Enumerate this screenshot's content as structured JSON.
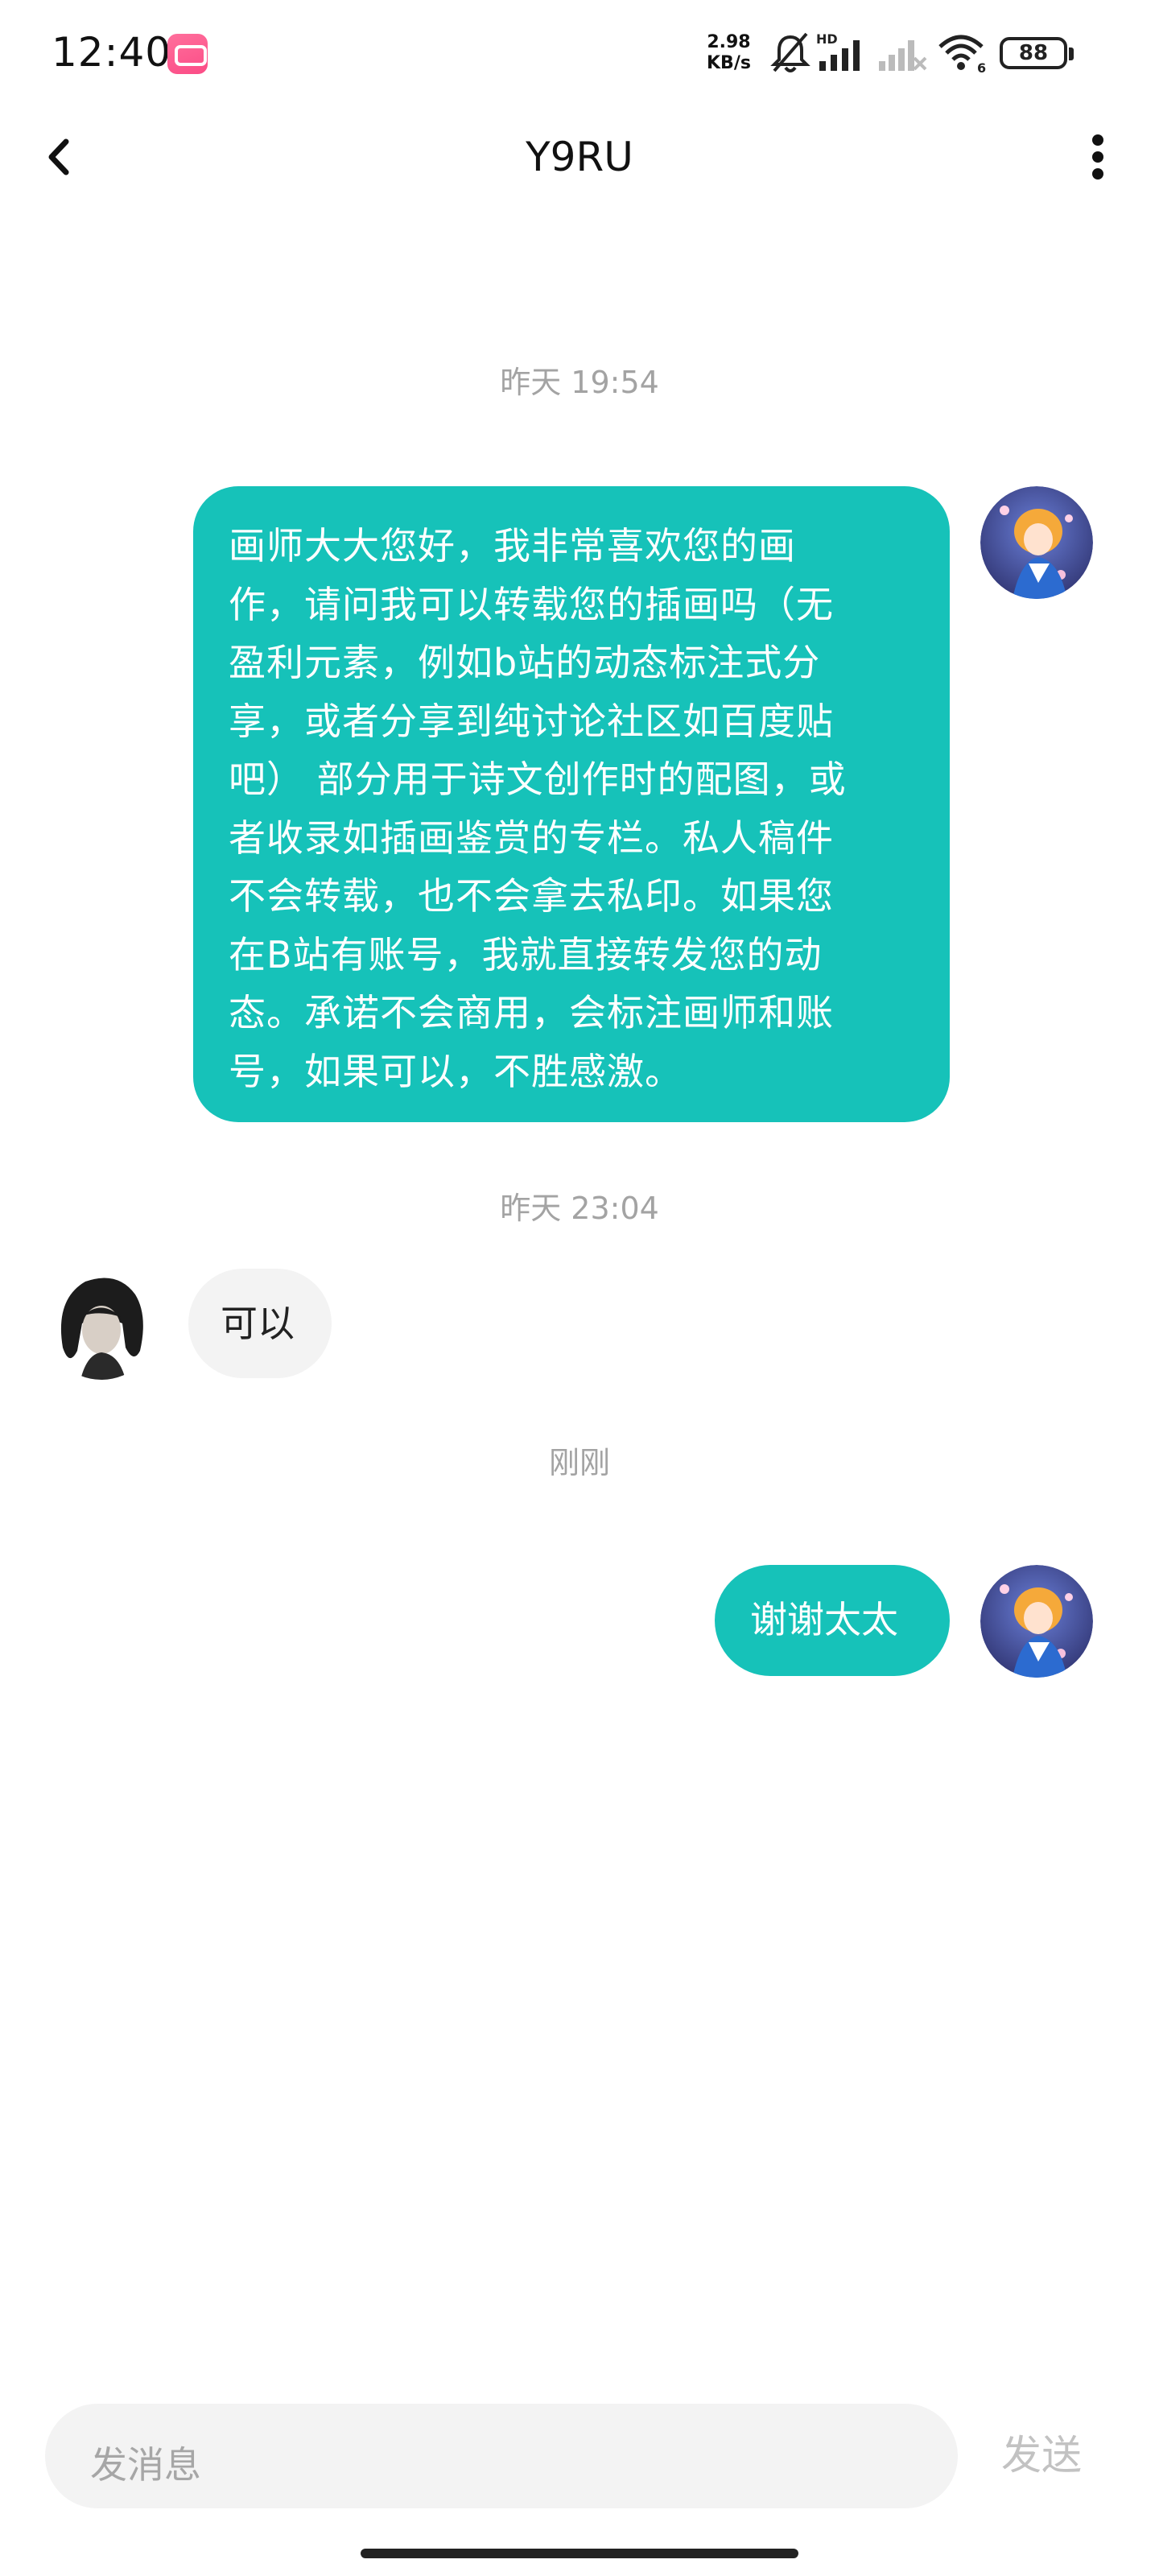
{
  "status_bar": {
    "time": "12:40",
    "network_speed_value": "2.98",
    "network_speed_unit": "KB/s",
    "battery": "88",
    "icons": [
      "bilibili-app-icon",
      "mute-bell-icon",
      "hd-signal-icon",
      "no-signal-icon",
      "wifi-icon",
      "battery-icon"
    ]
  },
  "header": {
    "title": "Y9RU",
    "back_icon": "chevron-left-icon",
    "more_icon": "vertical-ellipsis-icon"
  },
  "messages": [
    {
      "type": "time",
      "text": "昨天 19:54"
    },
    {
      "type": "outgoing",
      "lines": [
        "画师大大您好，我非常喜欢您的画",
        "作，请问我可以转载您的插画吗（无",
        "盈利元素，例如b站的动态标注式分",
        "享，或者分享到纯讨论社区如百度贴",
        "吧） 部分用于诗文创作时的配图，或",
        "者收录如插画鉴赏的专栏。私人稿件",
        "不会转载，也不会拿去私印。如果您",
        "在B站有账号，我就直接转发您的动",
        "态。承诺不会商用，会标注画师和账",
        "号，如果可以，不胜感激。"
      ]
    },
    {
      "type": "time",
      "text": "昨天 23:04"
    },
    {
      "type": "incoming",
      "text": "可以"
    },
    {
      "type": "time",
      "text": "刚刚"
    },
    {
      "type": "outgoing",
      "text": "谢谢太太"
    }
  ],
  "input": {
    "placeholder": "发消息",
    "send_label": "发送"
  },
  "colors": {
    "outgoing_bubble": "#16c2b9",
    "incoming_bubble": "#f3f3f3",
    "timestamp": "#a3a3a3"
  }
}
